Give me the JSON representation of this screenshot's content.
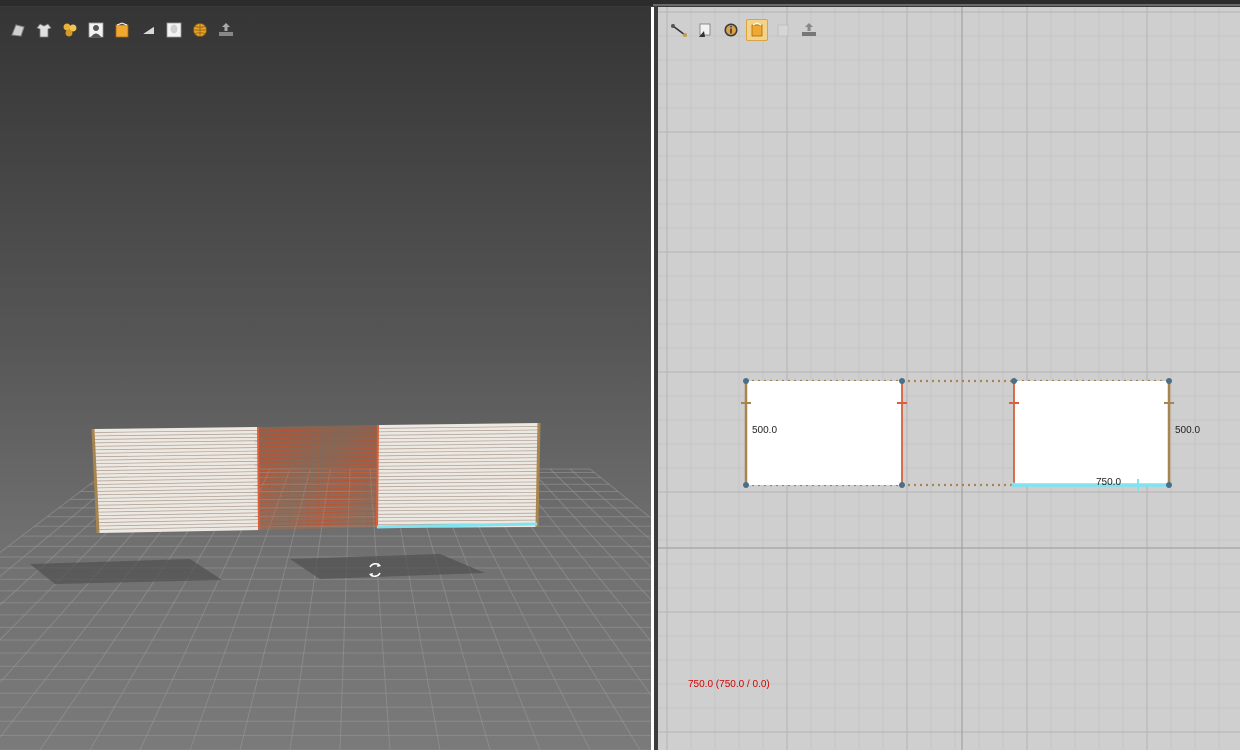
{
  "viewport_3d": {
    "toolbar": [
      {
        "icon": "avatar-tool-icon",
        "active": false
      },
      {
        "icon": "garment-tool-icon",
        "active": false
      },
      {
        "icon": "texture-tool-icon",
        "active": false
      },
      {
        "icon": "avatar-body-icon",
        "active": false
      },
      {
        "icon": "pattern-tool-icon",
        "active": false
      },
      {
        "icon": "fabric-tool-icon",
        "active": false
      },
      {
        "icon": "avatar-silhouette-icon",
        "active": false
      },
      {
        "icon": "globe-icon",
        "active": false
      },
      {
        "icon": "export-icon",
        "active": false
      }
    ]
  },
  "viewport_2d": {
    "toolbar": [
      {
        "icon": "segment-tool-icon",
        "active": false
      },
      {
        "icon": "transform-tool-icon",
        "active": false
      },
      {
        "icon": "info-icon",
        "active": false
      },
      {
        "icon": "pattern-tool-icon",
        "active": true
      },
      {
        "icon": "pattern-disabled-icon",
        "active": false
      },
      {
        "icon": "export-icon",
        "active": false
      }
    ],
    "left_panel_height_label": "500.0",
    "right_panel_height_label": "500.0",
    "right_panel_width_label": "750.0",
    "status_coordinate": "750.0 (750.0 / 0.0)"
  },
  "colors": {
    "seam_orange": "#d9603a",
    "edge_tan": "#a8854e",
    "selection_cyan": "#7fe3f0",
    "status_red": "#d40000"
  }
}
